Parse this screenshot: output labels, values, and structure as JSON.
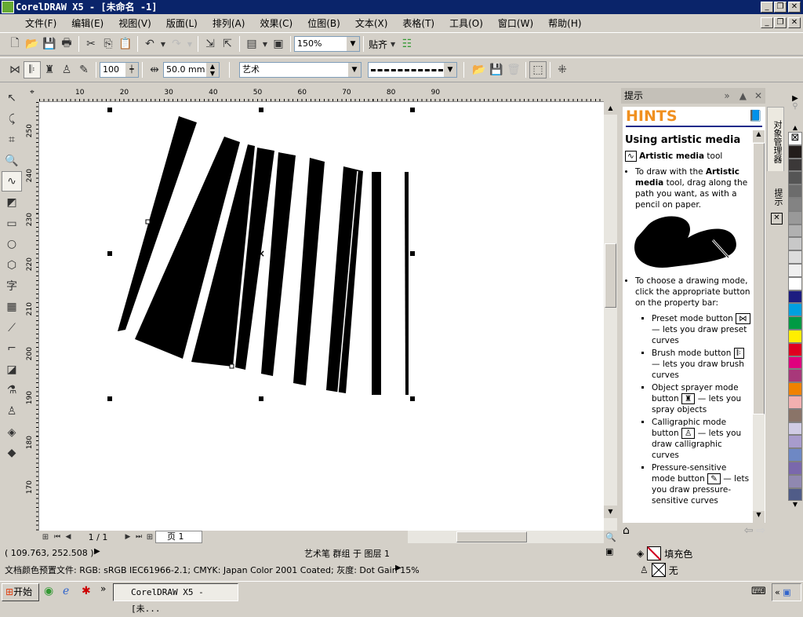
{
  "window": {
    "title": "CorelDRAW X5 - [未命名 -1]",
    "min": "_",
    "restore": "❐",
    "close": "✕"
  },
  "menu": [
    "文件(F)",
    "编辑(E)",
    "视图(V)",
    "版面(L)",
    "排列(A)",
    "效果(C)",
    "位图(B)",
    "文本(X)",
    "表格(T)",
    "工具(O)",
    "窗口(W)",
    "帮助(H)"
  ],
  "toolbar": {
    "zoom": "150%",
    "snap": "贴齐"
  },
  "property_bar": {
    "smoothing": "100",
    "width": "50.0 mm",
    "stroke_preset": "艺术",
    "stroke_style": "dashed"
  },
  "rulers": {
    "top": [
      "10",
      "20",
      "30",
      "40",
      "50",
      "60",
      "70",
      "80",
      "90"
    ],
    "left": [
      "250",
      "240",
      "230",
      "220",
      "210",
      "200",
      "190",
      "180",
      "170"
    ]
  },
  "page_nav": {
    "page_count": "1 / 1",
    "tab": "页 1"
  },
  "hints": {
    "panel_title": "提示",
    "header": "HINTS",
    "heading": "Using artistic media",
    "tool_name_bold": "Artistic media",
    "tool_name_rest": " tool",
    "p1_a": "To draw with the ",
    "p1_b": "Artistic media",
    "p1_c": " tool, drag along the path you want, as with a pencil on paper.",
    "p2": "To choose a drawing mode, click the appropriate button on the property bar:",
    "modes": [
      {
        "a": "Preset mode button",
        "b": "— lets you draw preset curves",
        "icon": "preset-icon"
      },
      {
        "a": "Brush mode button",
        "b": "— lets you draw brush curves",
        "icon": "brush-icon"
      },
      {
        "a": "Object sprayer mode button",
        "b": "— lets you spray objects",
        "icon": "sprayer-icon"
      },
      {
        "a": "Calligraphic mode button",
        "b": "— lets you draw calligraphic curves",
        "icon": "calligraphic-icon"
      },
      {
        "a": "Pressure-sensitive mode button",
        "b": "— lets you draw pressure-sensitive curves",
        "icon": "pressure-icon"
      }
    ],
    "side_tabs": [
      "对象管理器",
      "提示"
    ]
  },
  "palette": [
    "#231d1b",
    "#3b3838",
    "#555555",
    "#6c6c6c",
    "#838383",
    "#999999",
    "#b1b1b1",
    "#c8c8c8",
    "#dcdcdc",
    "#efefef",
    "#ffffff",
    "#1d1d80",
    "#00a0e0",
    "#009a44",
    "#ffee00",
    "#e00020",
    "#e0007e",
    "#a8387a",
    "#f08200",
    "#f2b0b0",
    "#8a7468",
    "#d0cce4",
    "#a89ccc",
    "#6e88c4",
    "#7a68ac",
    "#9088b0",
    "#505c88"
  ],
  "status": {
    "coords": "( 109.763, 252.508 )",
    "selection": "艺术笔 群组 于 图层 1",
    "color_profile": "文档颜色预置文件: RGB: sRGB IEC61966-2.1; CMYK: Japan Color 2001 Coated; 灰度: Dot Gain 15%",
    "fill": "填充色",
    "outline": "无"
  },
  "taskbar": {
    "start": "开始",
    "task": "CorelDRAW X5 - [未..."
  }
}
